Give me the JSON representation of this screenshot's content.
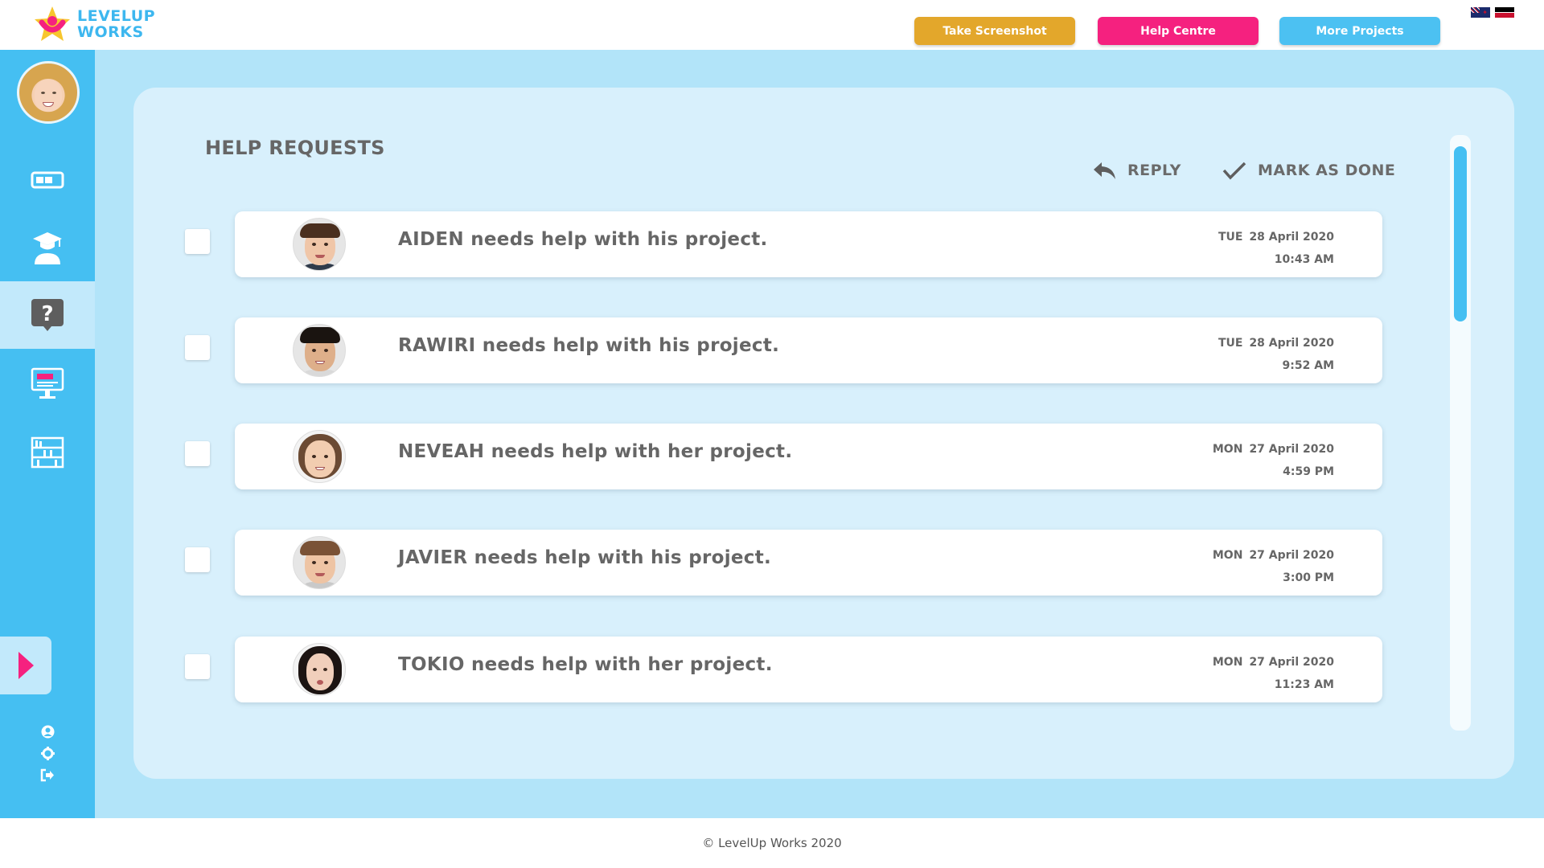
{
  "brand": {
    "line1": "LEVELUP",
    "line2": "WORKS"
  },
  "header": {
    "buttons": {
      "screenshot": "Take Screenshot",
      "help": "Help Centre",
      "projects": "More Projects"
    },
    "flags": [
      "nz-flag-icon",
      "maori-flag-icon"
    ]
  },
  "sidebar": {
    "items": [
      {
        "icon": "progress-icon"
      },
      {
        "icon": "student-icon"
      },
      {
        "icon": "help-request-icon",
        "active": true
      },
      {
        "icon": "submit-project-icon"
      },
      {
        "icon": "library-icon"
      }
    ],
    "bottom_icons": [
      "user-icon",
      "gear-icon",
      "logout-icon"
    ]
  },
  "page": {
    "title": "HELP REQUESTS"
  },
  "actions": {
    "reply": "REPLY",
    "mark_done": "MARK AS DONE"
  },
  "requests": [
    {
      "message": "AIDEN needs help with his project.",
      "day": "TUE",
      "date": "28 April 2020",
      "time": "10:43 AM"
    },
    {
      "message": "RAWIRI needs help with his project.",
      "day": "TUE",
      "date": "28 April 2020",
      "time": "9:52 AM"
    },
    {
      "message": "NEVEAH needs help with her project.",
      "day": "MON",
      "date": "27 April 2020",
      "time": "4:59 PM"
    },
    {
      "message": "JAVIER needs help with his project.",
      "day": "MON",
      "date": "27 April 2020",
      "time": "3:00 PM"
    },
    {
      "message": "TOKIO needs help with her project.",
      "day": "MON",
      "date": "27 April 2020",
      "time": "11:23 AM"
    }
  ],
  "footer": {
    "copyright": "© LevelUp Works 2020"
  },
  "colors": {
    "sidebar": "#45bff2",
    "main_bg": "#b2e4f9",
    "panel": "#d8f0fc",
    "screenshot_btn": "#e3a72b",
    "help_btn": "#f5217f",
    "projects_btn": "#4cc1f2"
  }
}
